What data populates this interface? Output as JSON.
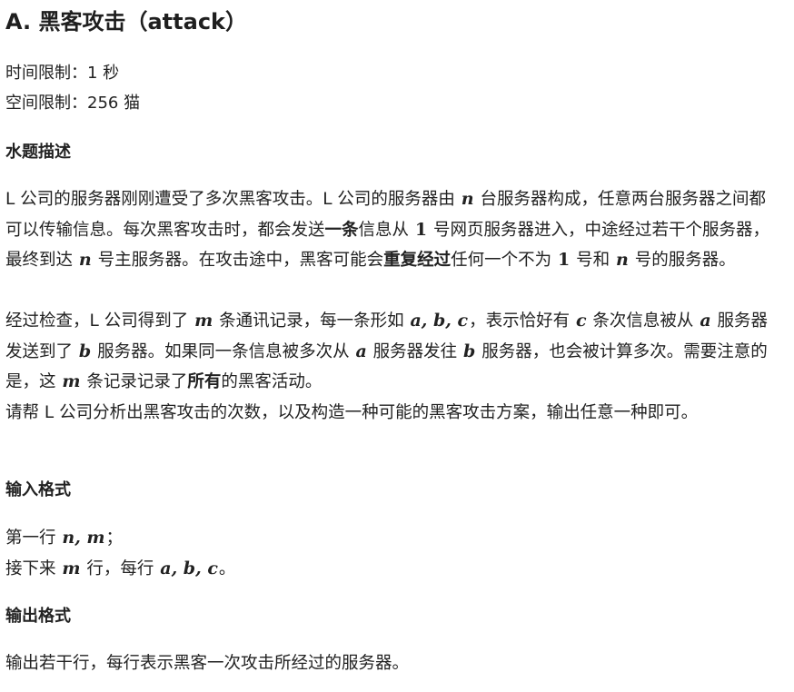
{
  "title": "A. 黑客攻击（attack）",
  "limits": {
    "time": "时间限制：1 秒",
    "space": "空间限制：256 猫"
  },
  "sections": {
    "description_title": "水题描述",
    "input_title": "输入格式",
    "output_title": "输出格式"
  },
  "description": {
    "p1": {
      "s1": "L 公司的服务器刚刚遭受了多次黑客攻击。L 公司的服务器由 ",
      "m1": "n",
      "s2": " 台服务器构成，任意两台服务器之间都可以传输信息。每次黑客攻击时，都会发送",
      "b1": "一条",
      "s3": "信息从 ",
      "m2": "1",
      "s4": " 号网页服务器进入，中途经过若干个服务器，最终到达 ",
      "m3": "n",
      "s5": " 号主服务器。在攻击途中，黑客可能会",
      "b2": "重复经过",
      "s6": "任何一个不为 ",
      "m4": "1",
      "s7": " 号和 ",
      "m5": "n",
      "s8": " 号的服务器。"
    },
    "p2": {
      "s1": "经过检查，L 公司得到了 ",
      "m1": "m",
      "s2": " 条通讯记录，每一条形如 ",
      "m2": "a, b, c",
      "s3": "，表示恰好有 ",
      "m3": "c",
      "s4": " 条次信息被从 ",
      "m4": "a",
      "s5": " 服务器发送到了 ",
      "m5": "b",
      "s6": " 服务器。如果同一条信息被多次从 ",
      "m6": "a",
      "s7": " 服务器发往 ",
      "m7": "b",
      "s8": " 服务器，也会被计算多次。需要注意的是，这 ",
      "m8": "m",
      "s9": " 条记录记录了",
      "b1": "所有",
      "s10": "的黑客活动。"
    },
    "p3": "请帮 L 公司分析出黑客攻击的次数，以及构造一种可能的黑客攻击方案，输出任意一种即可。"
  },
  "input": {
    "line1_prefix": "第一行 ",
    "line1_math": "n, m",
    "line1_suffix": "；",
    "line2_prefix": "接下来 ",
    "line2_math1": "m",
    "line2_mid": " 行，每行 ",
    "line2_math2": "a, b, c",
    "line2_suffix": "。"
  },
  "output": {
    "text": "输出若干行，每行表示黑客一次攻击所经过的服务器。"
  }
}
